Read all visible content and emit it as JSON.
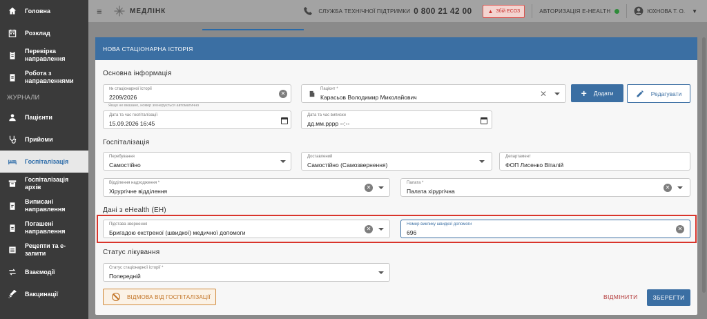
{
  "sidebar": {
    "items_top": [
      {
        "label": "Головна",
        "icon": "home-icon"
      },
      {
        "label": "Розклад",
        "icon": "calendar-icon"
      },
      {
        "label": "Перевірка направлення",
        "icon": "clipboard-check-icon"
      },
      {
        "label": "Робота з направленнями",
        "icon": "clipboard-list-icon"
      }
    ],
    "section_label": "ЖУРНАЛИ",
    "items_journals": [
      {
        "label": "Пацієнти",
        "icon": "user-icon"
      },
      {
        "label": "Прийоми",
        "icon": "stethoscope-icon"
      },
      {
        "label": "Госпіталізація",
        "icon": "bed-icon",
        "active": true
      },
      {
        "label": "Госпіталізація архів",
        "icon": "archive-icon"
      },
      {
        "label": "Виписані направлення",
        "icon": "clipboard-out-icon"
      },
      {
        "label": "Погашені направлення",
        "icon": "clipboard-done-icon"
      },
      {
        "label": "Рецепти та е-запити",
        "icon": "list-icon"
      },
      {
        "label": "Взаємодії",
        "icon": "swap-icon"
      },
      {
        "label": "Вакцинації",
        "icon": "syringe-icon"
      }
    ]
  },
  "topbar": {
    "logo_text": "МЕДЛІНК",
    "support_label": "СЛУЖБА ТЕХНІЧНОЇ ПІДТРИМКИ",
    "support_phone": "0 800 21 42 00",
    "esoz_label": "Збій ЕСОЗ",
    "auth_label": "АВТОРИЗАЦІЯ E-HEALTH",
    "user_name": "ЮХНОВА Т. О."
  },
  "modal": {
    "title": "НОВА СТАЦІОНАРНА ІСТОРІЯ",
    "sections": {
      "basic": "Основна інформація",
      "hosp": "Госпіталізація",
      "ehealth": "Дані з eHealth (ЕН)",
      "status": "Статус лікування"
    },
    "fields": {
      "history_no": {
        "label": "№ стаціонарної історії",
        "value": "2209/2026",
        "hint": "Якщо не вказано, номер згенерується автоматично"
      },
      "patient": {
        "label": "Пацієнт *",
        "value": "Карасьов Володимир Миколайович"
      },
      "admit_dt": {
        "label": "Дата та час госпіталізації",
        "value": "15.09.2026 16:45"
      },
      "discharge_dt": {
        "label": "Дата та час виписки",
        "value": "дд.мм.рррр --:--"
      },
      "stay": {
        "label": "Перебування",
        "value": "Самостійно"
      },
      "delivered": {
        "label": "Доставлений",
        "value": "Самостійно (Самозвернення)"
      },
      "department": {
        "label": "Департамент",
        "value": "ФОП Лисенко Віталій"
      },
      "admission_unit": {
        "label": "Відділення надходження *",
        "value": "Хірургічне відділення"
      },
      "ward": {
        "label": "Палата *",
        "value": "Палата хірургічна"
      },
      "basis": {
        "label": "Підстава звернення",
        "value": "Бригадою екстреної (швидкої) медичної допомоги"
      },
      "call_no": {
        "label": "Номер виклику швидкої допомоги",
        "value": "696"
      },
      "history_status": {
        "label": "Статус стаціонарної історії *",
        "value": "Попередній"
      }
    },
    "buttons": {
      "add": "Додати",
      "edit": "Редагувати",
      "refuse": "ВІДМОВА ВІД ГОСПІТАЛІЗАЦІЇ",
      "cancel": "ВІДМІНИТИ",
      "save": "ЗБЕРЕГТИ"
    }
  }
}
